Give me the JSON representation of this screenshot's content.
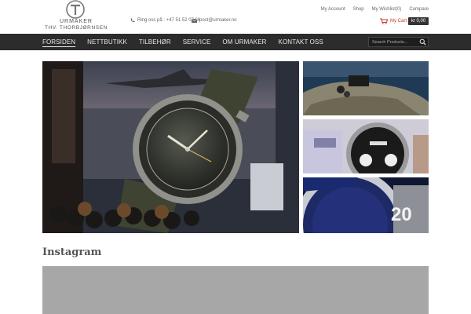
{
  "brand": {
    "line1": "URMAKER",
    "line2": "THV. THORBJØRNSEN"
  },
  "contact": {
    "phone": "Ring oss på : +47 51 52 07 66",
    "email": "post@urmaker.no"
  },
  "top_links": [
    "My Account",
    "Shop",
    "My Wishlist(0)",
    "Compare"
  ],
  "cart": {
    "label": "My Cart",
    "total": "kr 0,00"
  },
  "nav": {
    "items": [
      "FORSIDEN",
      "NETTBUTIKK",
      "TILBEHØR",
      "SERVICE",
      "OM URMAKER",
      "KONTAKT OSS"
    ],
    "active_index": 0
  },
  "search": {
    "placeholder": "Search Products..."
  },
  "gallery": {
    "hero_label": "Oris aviator watch with beaded bracelet",
    "thumbs": [
      "Watch on rock by the sea",
      "Alpina chronograph on wrist",
      "Blue dive watch close-up"
    ]
  },
  "instagram": {
    "title": "Instagram"
  },
  "colors": {
    "nav_bg": "#2c2c2c",
    "cart_accent": "#c0392b",
    "instagram_placeholder": "#a7a7a7"
  }
}
